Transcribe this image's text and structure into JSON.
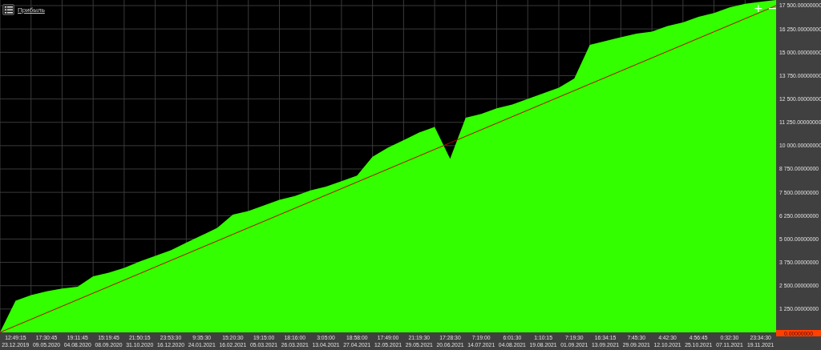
{
  "chart_data": {
    "type": "area",
    "ylim": [
      0,
      17800
    ],
    "grid": true,
    "categories": [
      null,
      "12:49:15\n23.12.2019",
      null,
      "17:30:45\n09.05.2020",
      null,
      "19:11:45\n04.08.2020",
      null,
      "15:19:45\n08.09.2020",
      null,
      "21:50:15\n31.10.2020",
      null,
      "23:53:30\n16.12.2020",
      null,
      "9:35:30\n24.01.2021",
      null,
      "15:20:30\n16.02.2021",
      null,
      "19:15:00\n05.03.2021",
      null,
      "18:16:00\n26.03.2021",
      null,
      "3:05:00\n13.04.2021",
      null,
      "18:58:00\n27.04.2021",
      null,
      "17:49:00\n12.05.2021",
      null,
      "21:19:30\n29.05.2021",
      null,
      "17:28:30\n20.06.2021",
      null,
      "7:19:00\n14.07.2021",
      null,
      "6:01:30\n04.08.2021",
      null,
      "1:10:15\n19.08.2021",
      null,
      "7:19:30\n01.09.2021",
      null,
      "16:34:15\n13.09.2021",
      null,
      "7:45:30\n29.09.2021",
      null,
      "4:42:30\n12.10.2021",
      null,
      "4:56:45\n25.10.2021",
      null,
      "0:32:30\n07.11.2021",
      null,
      "23:34:30\n19.11.2021",
      null
    ],
    "series": [
      {
        "name": "Прибыль",
        "color": "#33ff00",
        "values": [
          0,
          1700,
          2000,
          2200,
          2350,
          2450,
          3000,
          3200,
          3450,
          3800,
          4100,
          4400,
          4800,
          5200,
          5600,
          6300,
          6500,
          6800,
          7100,
          7300,
          7600,
          7800,
          8100,
          8400,
          9400,
          9900,
          10300,
          10700,
          11000,
          9300,
          11500,
          11700,
          12000,
          12200,
          12500,
          12800,
          13100,
          13600,
          15400,
          15600,
          15800,
          16000,
          16100,
          16400,
          16600,
          16900,
          17100,
          17400,
          17600,
          17700,
          17800
        ]
      },
      {
        "type": "line",
        "color": "#c00000",
        "values": [
          0,
          350,
          700,
          1050,
          1400,
          1750,
          2100,
          2450,
          2800,
          3150,
          3500,
          3850,
          4200,
          4550,
          4900,
          5250,
          5600,
          5950,
          6300,
          6650,
          7000,
          7350,
          7700,
          8050,
          8400,
          8750,
          9100,
          9450,
          9800,
          10150,
          10500,
          10850,
          11200,
          11550,
          11900,
          12250,
          12600,
          12950,
          13300,
          13650,
          14000,
          14350,
          14700,
          15050,
          15400,
          15750,
          16100,
          16450,
          16800,
          17150,
          17500
        ]
      }
    ],
    "yticks": [
      {
        "value": 1250,
        "label": "1 250.00000000"
      },
      {
        "value": 2500,
        "label": "2 500.00000000"
      },
      {
        "value": 3750,
        "label": "3 750.00000000"
      },
      {
        "value": 5000,
        "label": "5 000.00000000"
      },
      {
        "value": 6250,
        "label": "6 250.00000000"
      },
      {
        "value": 7500,
        "label": "7 500.00000000"
      },
      {
        "value": 8750,
        "label": "8 750.00000000"
      },
      {
        "value": 10000,
        "label": "10 000.00000000"
      },
      {
        "value": 11250,
        "label": "11 250.00000000"
      },
      {
        "value": 12500,
        "label": "12 500.00000000"
      },
      {
        "value": 13750,
        "label": "13 750.00000000"
      },
      {
        "value": 15000,
        "label": "15 000.00000000"
      },
      {
        "value": 16250,
        "label": "16 250.00000000"
      },
      {
        "value": 17500,
        "label": "17 500.00000000"
      }
    ]
  },
  "value_marker": {
    "label": "0.00000000",
    "color": "#ff4000"
  },
  "zoom_buttons": [
    "+",
    "−"
  ]
}
